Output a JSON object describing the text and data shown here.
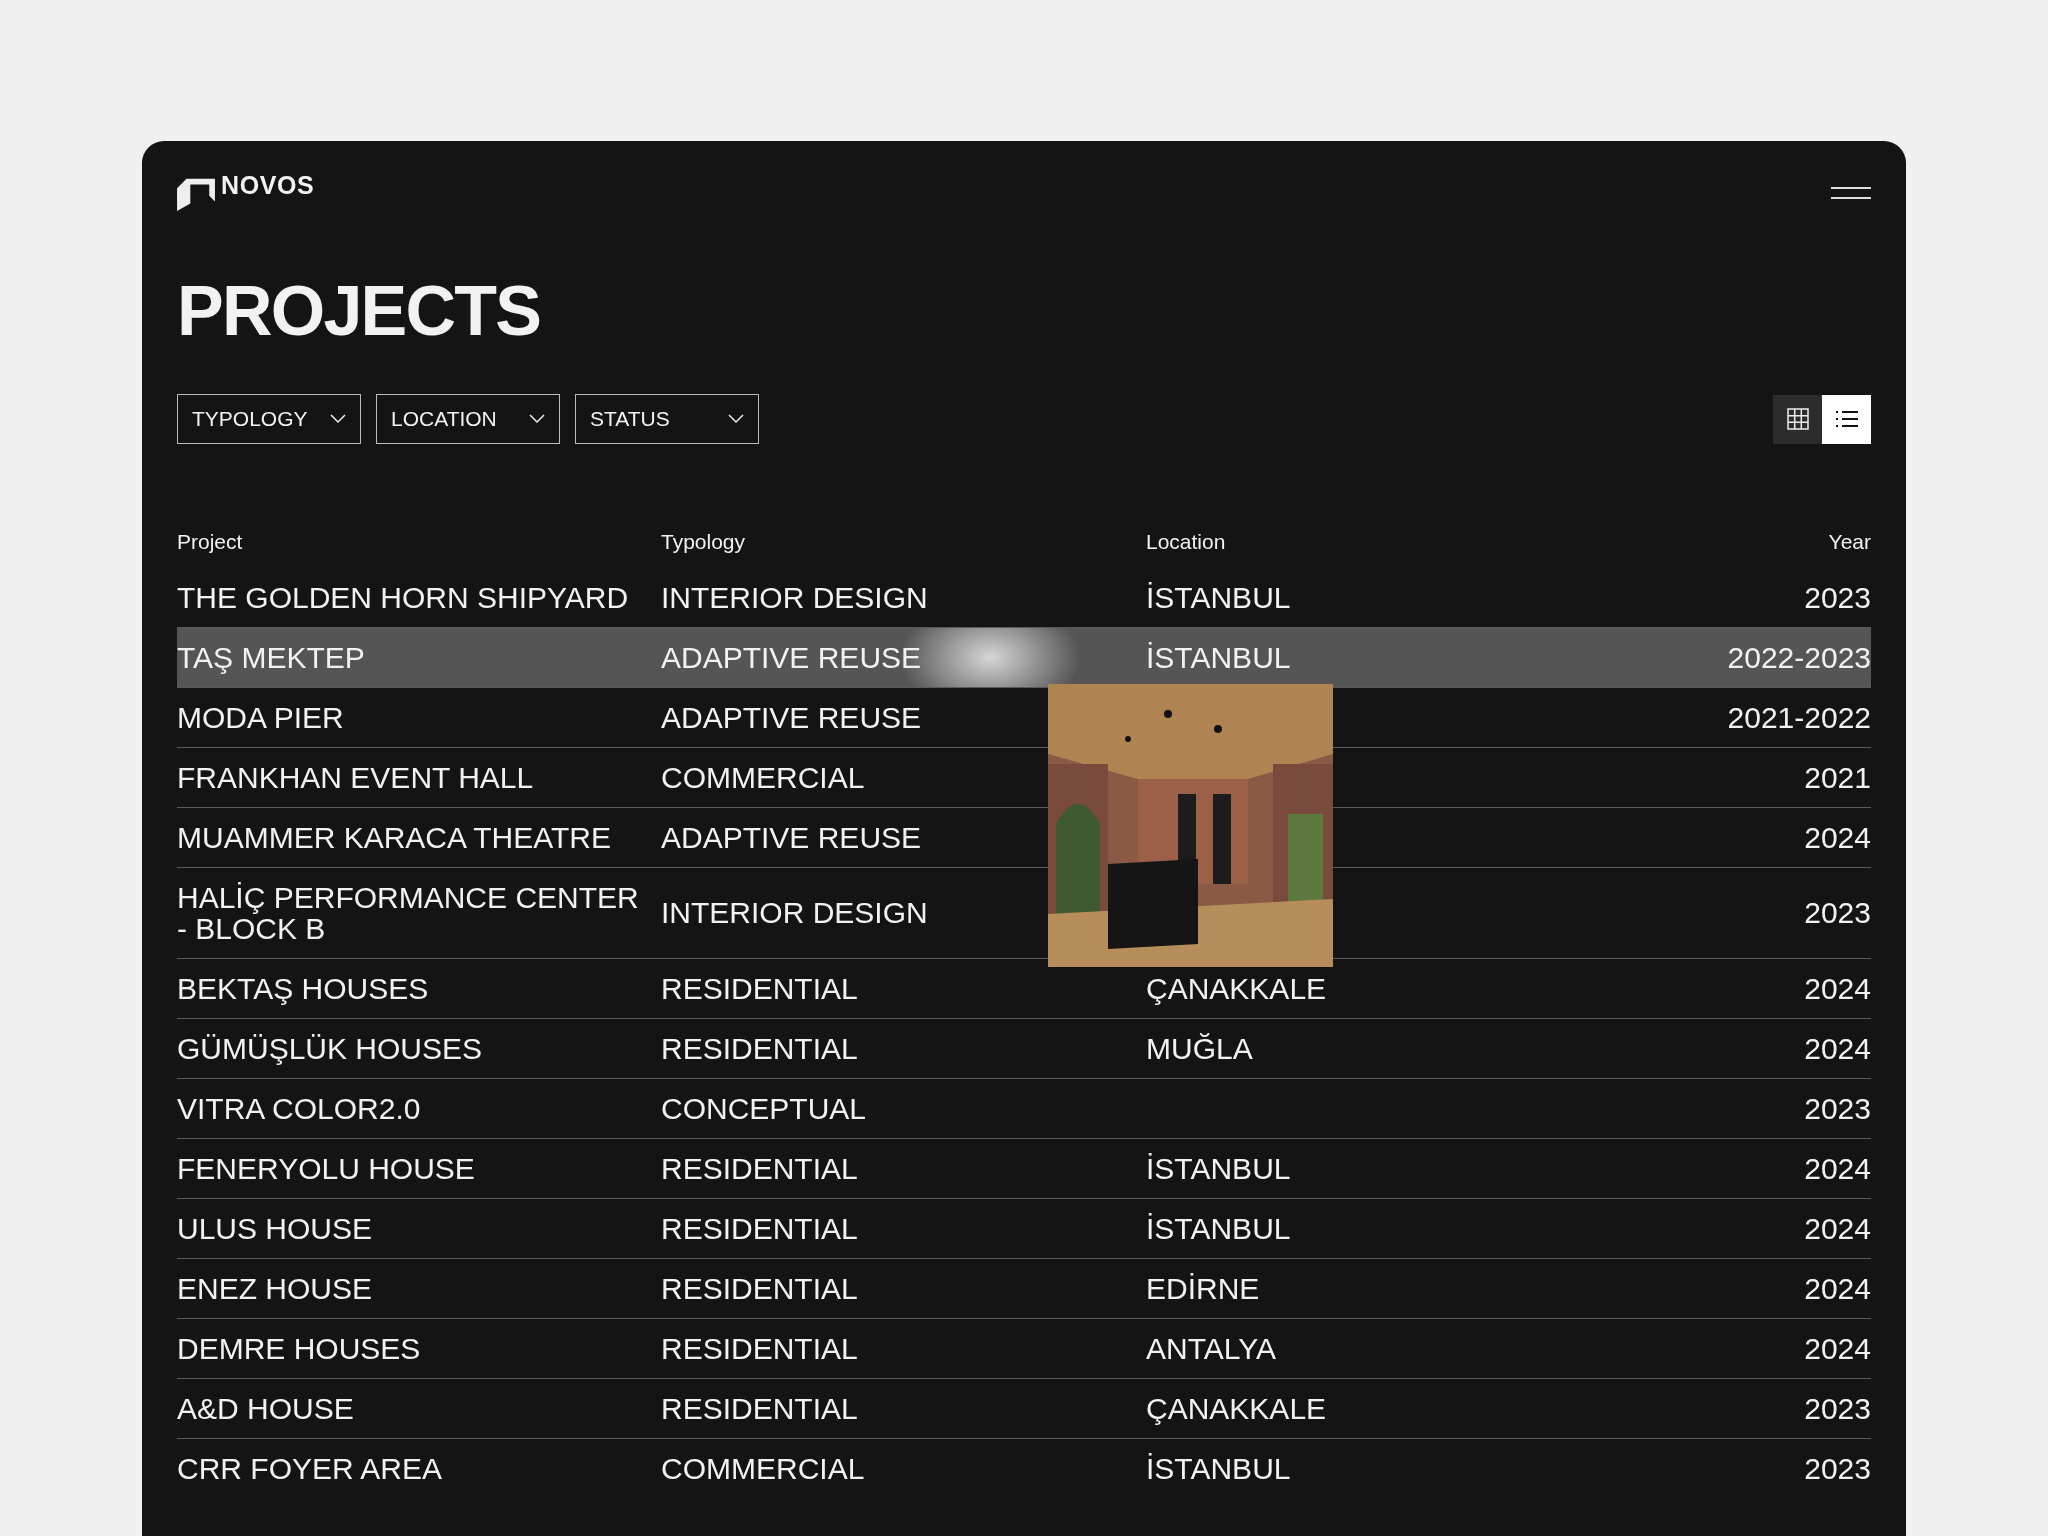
{
  "brand": "NOVOS",
  "title": "PROJECTS",
  "filters": [
    {
      "label": "TYPOLOGY"
    },
    {
      "label": "LOCATION"
    },
    {
      "label": "STATUS"
    }
  ],
  "view_toggle": [
    {
      "kind": "grid",
      "selected": false
    },
    {
      "kind": "list",
      "selected": true
    }
  ],
  "table": {
    "columns": [
      "Project",
      "Typology",
      "Location",
      "Year"
    ],
    "rows": [
      {
        "project": "THE GOLDEN HORN SHIPYARD",
        "typology": "INTERIOR DESIGN",
        "location": "İSTANBUL",
        "year": "2023",
        "selected": false
      },
      {
        "project": "TAŞ MEKTEP",
        "typology": "ADAPTIVE REUSE",
        "location": "İSTANBUL",
        "year": "2022-2023",
        "selected": true
      },
      {
        "project": "MODA PIER",
        "typology": "ADAPTIVE REUSE",
        "year": "2021-2022",
        "selected": false
      },
      {
        "project": "FRANKHAN EVENT HALL",
        "typology": "COMMERCIAL",
        "year": "2021",
        "selected": false
      },
      {
        "project": "MUAMMER KARACA THEATRE",
        "typology": "ADAPTIVE REUSE",
        "year": "2024",
        "selected": false
      },
      {
        "project": "HALİÇ PERFORMANCE CENTER - BLOCK B",
        "typology": "INTERIOR DESIGN",
        "year": "2023",
        "selected": false
      },
      {
        "project": "BEKTAŞ HOUSES",
        "typology": "RESIDENTIAL",
        "location": "ÇANAKKALE",
        "year": "2024",
        "selected": false
      },
      {
        "project": "GÜMÜŞLÜK HOUSES",
        "typology": "RESIDENTIAL",
        "location": "MUĞLA",
        "year": "2024",
        "selected": false
      },
      {
        "project": "VITRA COLOR2.0",
        "typology": "CONCEPTUAL",
        "year": "2023",
        "selected": false
      },
      {
        "project": "FENERYOLU HOUSE",
        "typology": "RESIDENTIAL",
        "location": "İSTANBUL",
        "year": "2024",
        "selected": false
      },
      {
        "project": "ULUS HOUSE",
        "typology": "RESIDENTIAL",
        "location": "İSTANBUL",
        "year": "2024",
        "selected": false
      },
      {
        "project": "ENEZ HOUSE",
        "typology": "RESIDENTIAL",
        "location": "EDİRNE",
        "year": "2024",
        "selected": false
      },
      {
        "project": "DEMRE HOUSES",
        "typology": "RESIDENTIAL",
        "location": "ANTALYA",
        "year": "2024",
        "selected": false
      },
      {
        "project": "A&D HOUSE",
        "typology": "RESIDENTIAL",
        "location": "ÇANAKKALE",
        "year": "2023",
        "selected": false
      },
      {
        "project": "CRR FOYER AREA",
        "typology": "COMMERCIAL",
        "location": "İSTANBUL",
        "year": "2023",
        "selected": false
      }
    ]
  }
}
